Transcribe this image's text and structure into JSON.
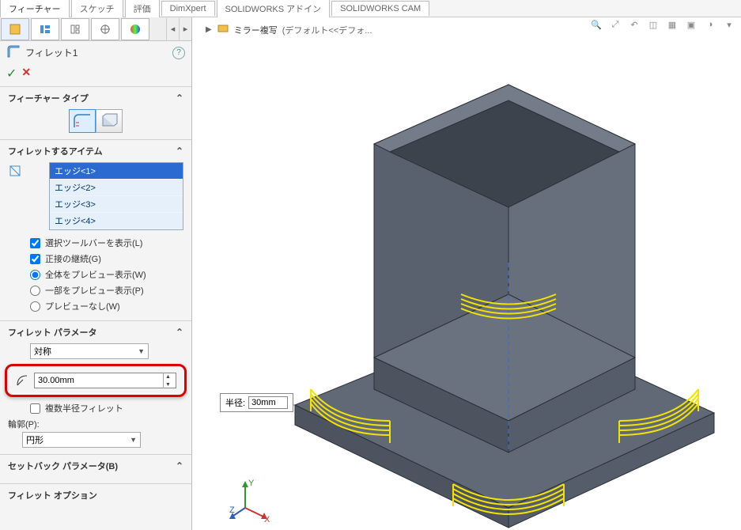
{
  "top_tabs": [
    "フィーチャー",
    "スケッチ",
    "評価",
    "DimXpert",
    "SOLIDWORKS アドイン",
    "SOLIDWORKS CAM"
  ],
  "breadcrumb": {
    "doc_name": "ミラー複写",
    "state": "(デフォルト<<デフォ..."
  },
  "feature": {
    "name": "フィレット1",
    "type_header": "フィーチャー タイプ",
    "items_header": "フィレットするアイテム",
    "edges": [
      "エッジ<1>",
      "エッジ<2>",
      "エッジ<3>",
      "エッジ<4>"
    ],
    "show_toolbar": "選択ツールバーを表示(L)",
    "tangent_prop": "正接の継続(G)",
    "preview_full": "全体をプレビュー表示(W)",
    "preview_partial": "一部をプレビュー表示(P)",
    "preview_none": "プレビューなし(W)",
    "params_header": "フィレット パラメータ",
    "symmetry": "対称",
    "radius_value": "30.00mm",
    "multi_radius": "複数半径フィレット",
    "profile_label": "輪郭(P):",
    "profile_value": "円形",
    "setback_header": "セットバック パラメータ(B)",
    "options_header": "フィレット オプション"
  },
  "callout": {
    "label": "半径:",
    "value": "30mm"
  },
  "icons": {
    "feature_tree": "◧",
    "config": "≡",
    "display": "◨",
    "reference": "⊕",
    "appearance": "◐",
    "fillet": "⬭",
    "ok": "✓",
    "cancel": "✕",
    "help": "?"
  }
}
